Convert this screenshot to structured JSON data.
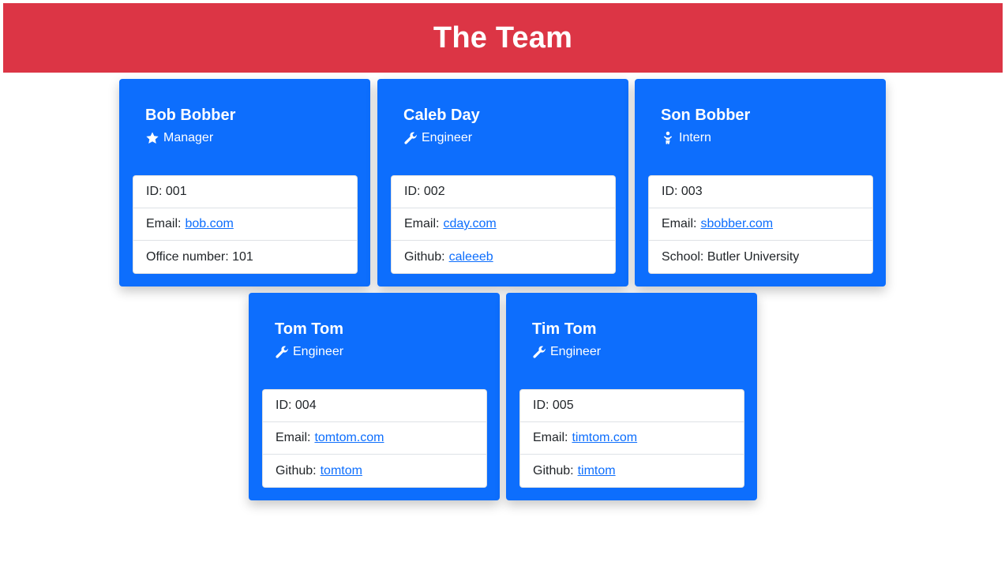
{
  "header": {
    "title": "The Team"
  },
  "colors": {
    "header_bg": "#dc3545",
    "card_bg": "#0d6efd",
    "link": "#0d6efd"
  },
  "employees": [
    {
      "name": "Bob Bobber",
      "role": "Manager",
      "role_icon": "star-icon",
      "id_label": "ID:",
      "id": "001",
      "email_label": "Email:",
      "email": "bob.com",
      "extra_label": "Office number:",
      "extra": "101",
      "extra_is_link": false
    },
    {
      "name": "Caleb Day",
      "role": "Engineer",
      "role_icon": "wrench-icon",
      "id_label": "ID:",
      "id": "002",
      "email_label": "Email:",
      "email": "cday.com",
      "extra_label": "Github:",
      "extra": "caleeeb",
      "extra_is_link": true
    },
    {
      "name": "Son Bobber",
      "role": "Intern",
      "role_icon": "child-icon",
      "id_label": "ID:",
      "id": "003",
      "email_label": "Email:",
      "email": "sbobber.com",
      "extra_label": "School:",
      "extra": "Butler University",
      "extra_is_link": false
    },
    {
      "name": "Tom Tom",
      "role": "Engineer",
      "role_icon": "wrench-icon",
      "id_label": "ID:",
      "id": "004",
      "email_label": "Email:",
      "email": "tomtom.com",
      "extra_label": "Github:",
      "extra": "tomtom",
      "extra_is_link": true
    },
    {
      "name": "Tim Tom",
      "role": "Engineer",
      "role_icon": "wrench-icon",
      "id_label": "ID:",
      "id": "005",
      "email_label": "Email:",
      "email": "timtom.com",
      "extra_label": "Github:",
      "extra": "timtom",
      "extra_is_link": true
    }
  ]
}
